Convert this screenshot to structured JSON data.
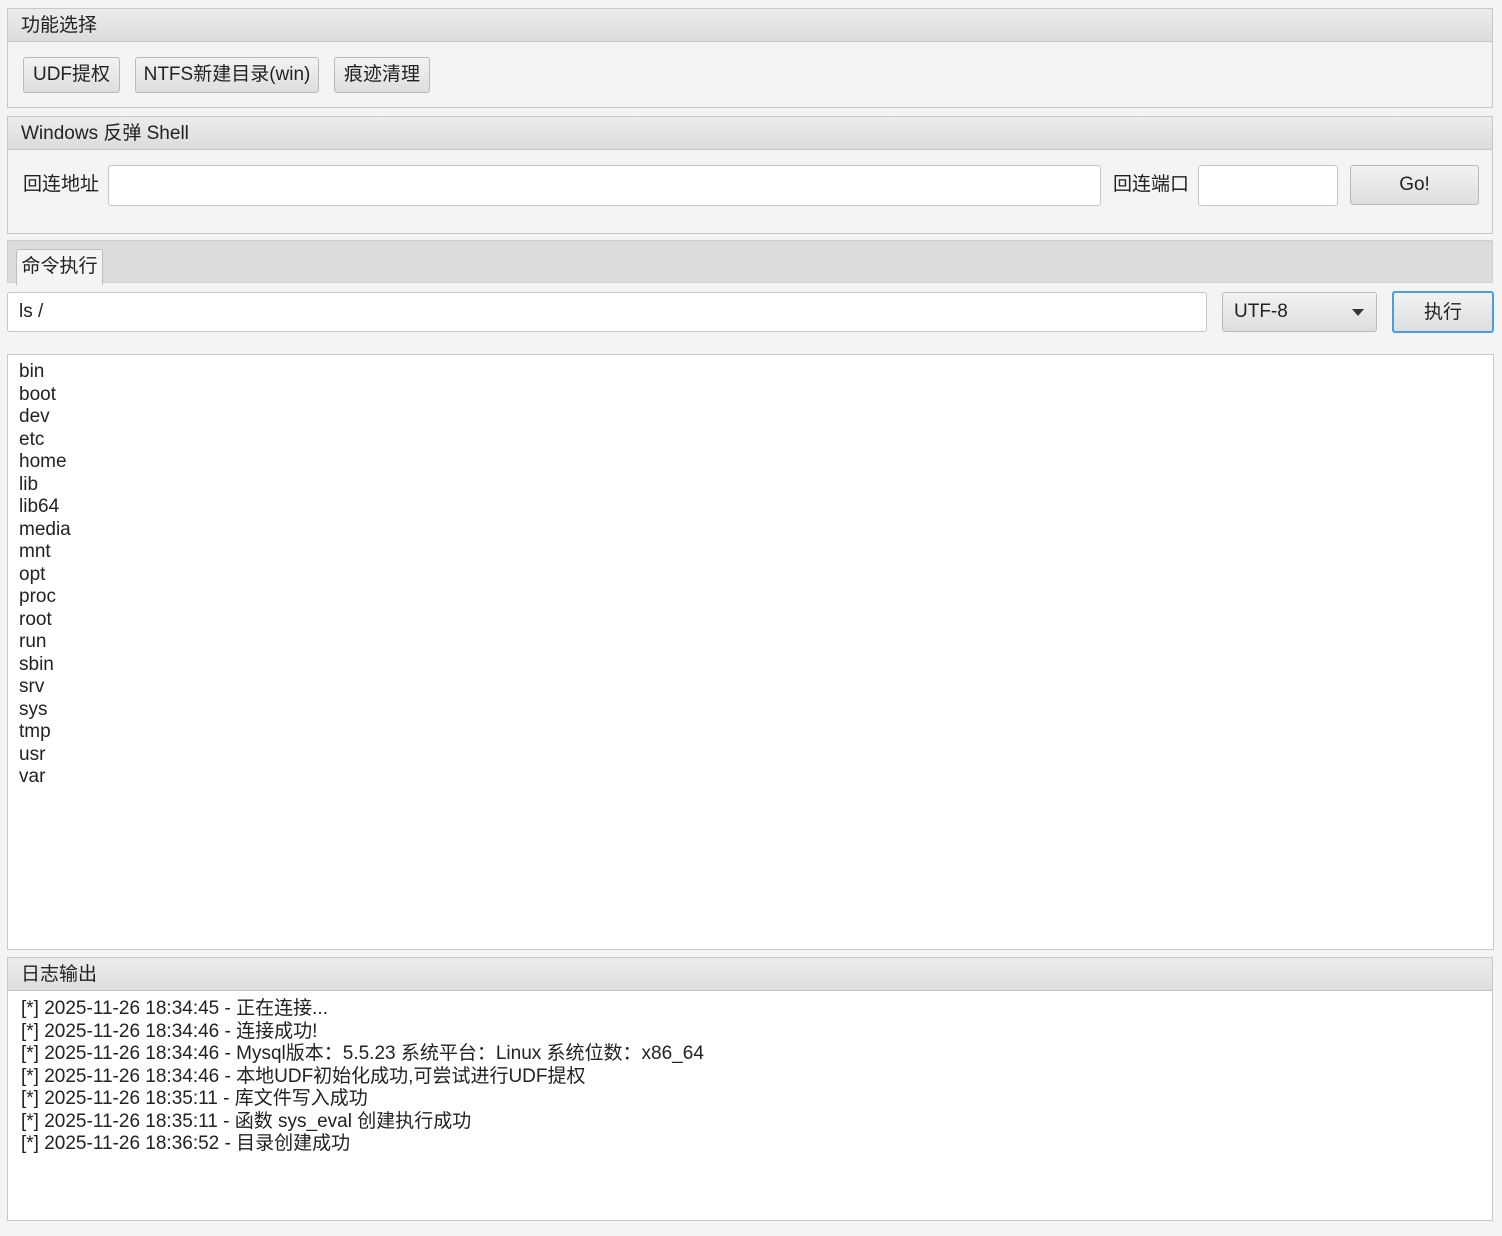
{
  "func_panel": {
    "title": "功能选择",
    "buttons": [
      "UDF提权",
      "NTFS新建目录(win)",
      "痕迹清理"
    ]
  },
  "shell_panel": {
    "title": "Windows 反弹 Shell",
    "host_label": "回连地址",
    "host_value": "",
    "port_label": "回连端口",
    "port_value": "",
    "go_label": "Go!"
  },
  "cmd_tab": {
    "tab_label": "命令执行",
    "command_value": "ls /",
    "encoding": "UTF-8",
    "exec_label": "执行"
  },
  "output": {
    "lines": [
      "bin",
      "boot",
      "dev",
      "etc",
      "home",
      "lib",
      "lib64",
      "media",
      "mnt",
      "opt",
      "proc",
      "root",
      "run",
      "sbin",
      "srv",
      "sys",
      "tmp",
      "usr",
      "var"
    ]
  },
  "log_panel": {
    "title": "日志输出",
    "lines": [
      "[*] 2025-11-26 18:34:45 - 正在连接...",
      "[*] 2025-11-26 18:34:46 - 连接成功!",
      "[*] 2025-11-26 18:34:46 - Mysql版本：5.5.23 系统平台：Linux 系统位数：x86_64",
      "[*] 2025-11-26 18:34:46 - 本地UDF初始化成功,可尝试进行UDF提权",
      "[*] 2025-11-26 18:35:11 - 库文件写入成功",
      "[*] 2025-11-26 18:35:11 - 函数 sys_eval 创建执行成功",
      "[*] 2025-11-26 18:36:52 - 目录创建成功"
    ]
  },
  "colors": {
    "accent_focus": "#4a9ee0"
  }
}
